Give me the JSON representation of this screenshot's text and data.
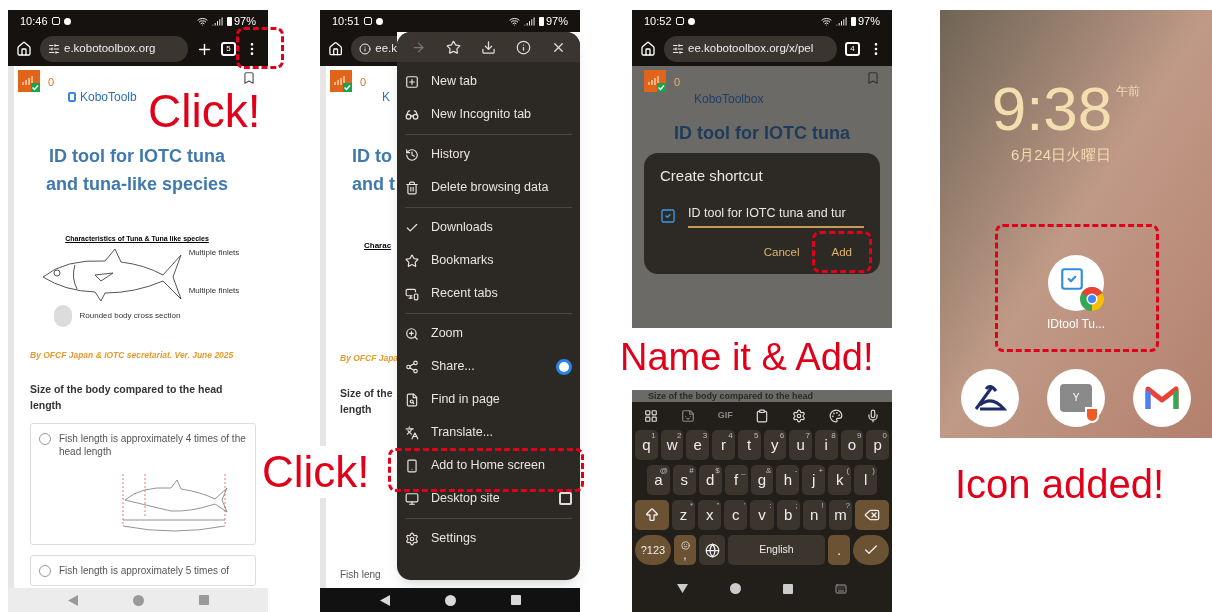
{
  "step1": {
    "status": {
      "time": "10:46",
      "battery": "97%"
    },
    "toolbar": {
      "url": "e.kobotoolbox.org",
      "tab_count": "5"
    },
    "page": {
      "score": "0",
      "logo": "KoboToolb",
      "title": "ID tool for IOTC tuna and tuna-like species",
      "figure_caption": "Characteristics of Tuna & Tuna like species",
      "figure_labels": [
        "Multiple finlets",
        "Multiple finlets",
        "Rounded body cross section"
      ],
      "credit": "By OFCF Japan & IOTC secretariat. Ver. June 2025",
      "question": "Size of the body compared to the head length",
      "options": [
        {
          "kind": "image",
          "text": "Fish length is approximately 4 times of the head length",
          "selected": false
        },
        {
          "kind": "text",
          "text": "Fish length is approximately 5 times of",
          "selected": false
        }
      ]
    },
    "callout": "Click!"
  },
  "step2": {
    "status": {
      "time": "10:51",
      "battery": "97%"
    },
    "toolbar": {
      "url": "ee.k"
    },
    "page": {
      "score": "0",
      "logo": "K",
      "title_lines": [
        "ID to",
        "and t"
      ],
      "caption": "Charac",
      "credit": "By OFCF Japa",
      "question_lines": [
        "Size of the",
        "length"
      ],
      "option": "Fish leng"
    },
    "menu": {
      "groups": [
        {
          "items": [
            {
              "kind": "action",
              "label": "New tab"
            },
            {
              "kind": "action",
              "label": "New Incognito tab"
            }
          ]
        },
        {
          "items": [
            {
              "kind": "action",
              "label": "History"
            },
            {
              "kind": "action",
              "label": "Delete browsing data"
            }
          ]
        },
        {
          "items": [
            {
              "kind": "action",
              "label": "Downloads"
            },
            {
              "kind": "action",
              "label": "Bookmarks"
            },
            {
              "kind": "action",
              "label": "Recent tabs"
            }
          ]
        },
        {
          "items": [
            {
              "kind": "action",
              "label": "Zoom"
            },
            {
              "kind": "share",
              "label": "Share..."
            },
            {
              "kind": "action",
              "label": "Find in page"
            },
            {
              "kind": "action",
              "label": "Translate..."
            },
            {
              "kind": "action",
              "label": "Add to Home screen"
            },
            {
              "kind": "checkbox",
              "label": "Desktop site",
              "checked": false
            }
          ]
        },
        {
          "items": [
            {
              "kind": "action",
              "label": "Settings"
            }
          ]
        }
      ]
    },
    "callout": "Click!"
  },
  "step3": {
    "status": {
      "time": "10:52",
      "battery": "97%"
    },
    "toolbar": {
      "url": "ee.kobotoolbox.org/x/pel",
      "tab_count": "4"
    },
    "page": {
      "score": "0",
      "logo": "KoboToolbox",
      "title": "ID tool for IOTC tuna"
    },
    "dialog": {
      "title": "Create shortcut",
      "value": "ID tool for IOTC tuna and tur",
      "buttons": [
        "Cancel",
        "Add"
      ]
    },
    "callout": "Name it & Add!",
    "keyboard": {
      "page_strip": "Size of the body compared to the head",
      "gif": "GIF",
      "rows": [
        [
          {
            "label": "q",
            "hint": "1"
          },
          {
            "label": "w",
            "hint": "2"
          },
          {
            "label": "e",
            "hint": "3"
          },
          {
            "label": "r",
            "hint": "4"
          },
          {
            "label": "t",
            "hint": "5"
          },
          {
            "label": "y",
            "hint": "6"
          },
          {
            "label": "u",
            "hint": "7"
          },
          {
            "label": "i",
            "hint": "8"
          },
          {
            "label": "o",
            "hint": "9"
          },
          {
            "label": "p",
            "hint": "0"
          }
        ],
        [
          {
            "label": "a",
            "hint": "@"
          },
          {
            "label": "s",
            "hint": "#"
          },
          {
            "label": "d",
            "hint": "$"
          },
          {
            "label": "f",
            "hint": "_"
          },
          {
            "label": "g",
            "hint": "&"
          },
          {
            "label": "h",
            "hint": "-"
          },
          {
            "label": "j",
            "hint": "+"
          },
          {
            "label": "k",
            "hint": "("
          },
          {
            "label": "l",
            "hint": ")"
          }
        ],
        [
          {
            "label": "z",
            "hint": "*"
          },
          {
            "label": "x",
            "hint": "\""
          },
          {
            "label": "c",
            "hint": "'"
          },
          {
            "label": "v",
            "hint": ":"
          },
          {
            "label": "b",
            "hint": ";"
          },
          {
            "label": "n",
            "hint": "!"
          },
          {
            "label": "m",
            "hint": "?"
          }
        ]
      ],
      "symbols": "?123",
      "comma": ",",
      "space": "English",
      "period": "."
    }
  },
  "step4": {
    "clock": "9:38",
    "meridiem": "午前",
    "date": "6月24日火曜日",
    "shortcut_label": "IDtool Tu...",
    "dock_badge": "Y",
    "callout": "Icon added!"
  }
}
